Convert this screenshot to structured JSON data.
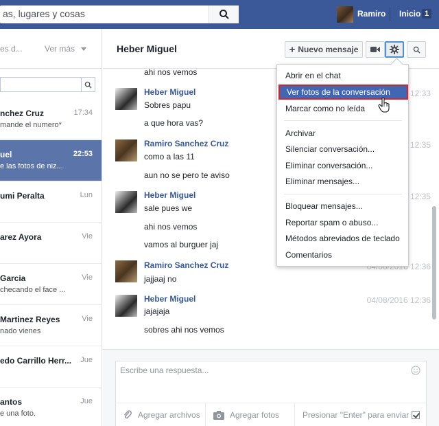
{
  "topbar": {
    "search_placeholder": "as, lugares y cosas",
    "user_name": "Ramiro",
    "home_label": "Inicio",
    "home_badge": "1",
    "bg_color": "#3b5998"
  },
  "left": {
    "tab_partial": "es d...",
    "more_label": "Ver más",
    "conversations": [
      {
        "name": "nchez Cruz",
        "snippet": "mande el numero*",
        "time": "17:34",
        "active": false
      },
      {
        "name": "uel",
        "snippet": "e las fotos de niz...",
        "time": "22:53",
        "active": true
      },
      {
        "name": "umi Peralta",
        "snippet": "",
        "time": "Lun",
        "active": false
      },
      {
        "name": "arez Ayora",
        "snippet": "",
        "time": "Vie",
        "active": false
      },
      {
        "name": "Garcia",
        "snippet": "checando el face ...",
        "time": "Vie",
        "active": false
      },
      {
        "name": "Martinez Reyes",
        "snippet": "nado vienes",
        "time": "Vie",
        "active": false
      },
      {
        "name": "edo Carrillo Herr...",
        "snippet": "",
        "time": "Jue",
        "active": false
      },
      {
        "name": "antos",
        "snippet": "e una foto.",
        "time": "Jue",
        "active": false
      }
    ]
  },
  "chat": {
    "title": "Heber Miguel",
    "new_message_label": "Nuevo mensaje",
    "messages": [
      {
        "author": "",
        "lines": [
          "ahi nos vemos"
        ],
        "time": ""
      },
      {
        "author": "Heber Miguel",
        "lines": [
          "Sobres papu",
          "a que hora vas?"
        ],
        "time": "12:33",
        "avatar": "heber"
      },
      {
        "author": "Ramiro Sanchez Cruz",
        "lines": [
          "como a las 11",
          "aun no se pero te aviso"
        ],
        "time": "12:35",
        "avatar": "ramiro"
      },
      {
        "author": "Heber Miguel",
        "lines": [
          "sale pues we",
          "ahi nos vemos",
          "vamos al burguer jaj"
        ],
        "time": "12:35",
        "avatar": "heber"
      },
      {
        "author": "Ramiro Sanchez Cruz",
        "lines": [
          "jajjaaj no"
        ],
        "time": "04/08/2016 12:36",
        "avatar": "ramiro"
      },
      {
        "author": "Heber Miguel",
        "lines": [
          "jajajaja",
          "sobres ahi nos vemos"
        ],
        "time": "04/08/2016 12:36",
        "avatar": "heber"
      }
    ]
  },
  "reply": {
    "placeholder": "Escribe una respuesta...",
    "attach_label": "Agregar archivos",
    "photo_label": "Agregar fotos",
    "enter_label": "Presionar \"Enter\" para enviar"
  },
  "dropdown": {
    "items": [
      "Abrir en el chat",
      "Ver fotos de la conversación",
      "Marcar como no leída",
      "Archivar",
      "Silenciar conversación...",
      "Eliminar conversación...",
      "Eliminar mensajes...",
      "Bloquear mensajes...",
      "Reportar spam o abuso...",
      "Métodos abreviados de teclado",
      "Comentarios"
    ],
    "highlighted_index": 1,
    "highlight_color": "#4267b2"
  }
}
